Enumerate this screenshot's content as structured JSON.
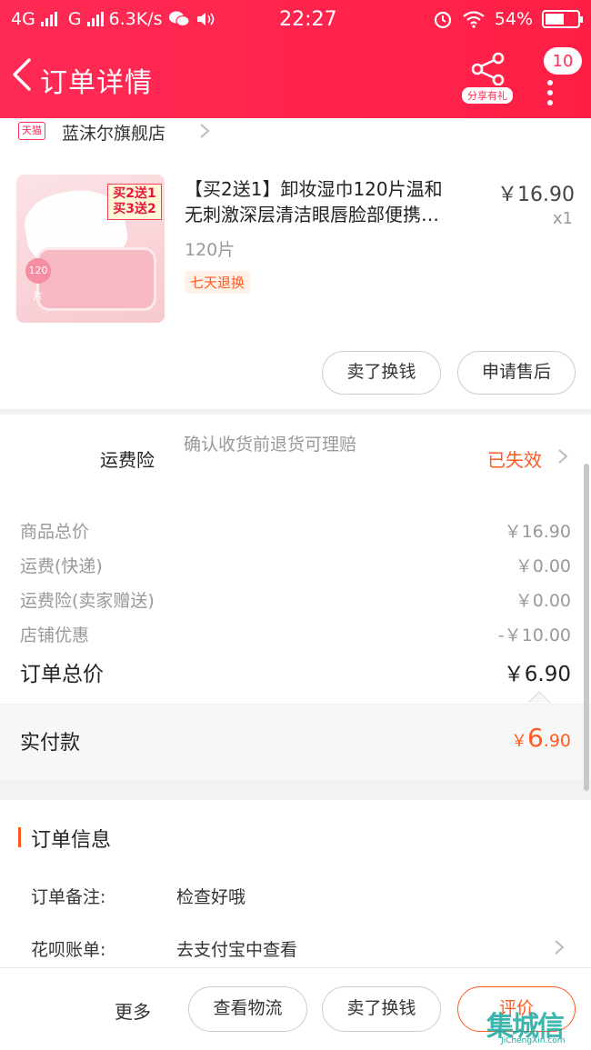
{
  "status_bar": {
    "network_1": "4G",
    "network_2": "G",
    "speed": "6.3K/s",
    "time": "22:27",
    "battery": "54%"
  },
  "header": {
    "title": "订单详情",
    "share_label": "分享有礼",
    "badge_count": "10"
  },
  "store": {
    "badge": "天猫",
    "name": "蓝沫尔旗舰店"
  },
  "product": {
    "name_line1": "【买2送1】卸妆湿巾120片温和",
    "name_line2": "无刺激深层清洁眼唇脸部便携…",
    "price": "￥16.90",
    "quantity": "x1",
    "sku": "120片",
    "tag": "七天退换",
    "image_promo_line1": "买2送1",
    "image_promo_line2": "买3送2",
    "image_count": "120片",
    "sell_button": "卖了换钱",
    "after_sale_button": "申请售后"
  },
  "insurance": {
    "label": "运费险",
    "description": "确认收货前退货可理赔",
    "status": "已失效"
  },
  "summary": {
    "rows": [
      {
        "label": "商品总价",
        "value": "￥16.90"
      },
      {
        "label": "运费(快递)",
        "value": "￥0.00"
      },
      {
        "label": "运费险(卖家赠送)",
        "value": "￥0.00"
      },
      {
        "label": "店铺优惠",
        "value": "-￥10.00"
      }
    ],
    "total_label": "订单总价",
    "total_value": "￥6.90"
  },
  "paid": {
    "label": "实付款",
    "currency": "￥",
    "integer": "6",
    "decimal": ".90"
  },
  "order_info": {
    "title": "订单信息",
    "note_label": "订单备注:",
    "note_value": "检查好哦",
    "huabei_label": "花呗账单:",
    "huabei_value": "去支付宝中查看"
  },
  "bottom_bar": {
    "more": "更多",
    "logistics": "查看物流",
    "sell": "卖了换钱",
    "rate": "评价"
  },
  "watermark": {
    "logo": "集城信",
    "url": "JiChengXin.com"
  },
  "colors": {
    "header": "#ff2a55",
    "accent": "#ff5a1f"
  }
}
